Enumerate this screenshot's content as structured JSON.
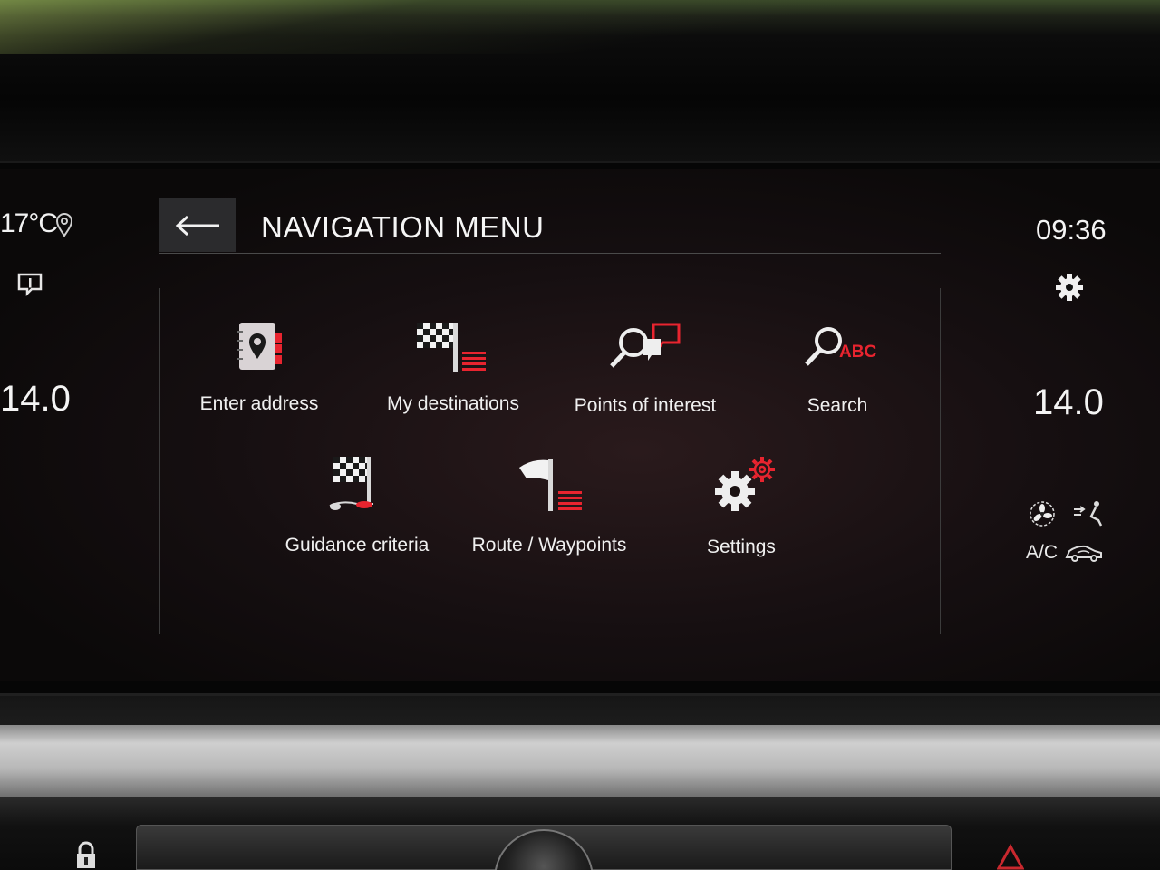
{
  "left_panel": {
    "temperature": "17°C",
    "value": "14.0"
  },
  "right_panel": {
    "clock": "09:36",
    "value": "14.0",
    "ac_label": "A/C"
  },
  "header": {
    "title": "NAVIGATION MENU"
  },
  "menu": {
    "items": [
      {
        "label": "Enter address",
        "icon": "address-book-pin-icon"
      },
      {
        "label": "My destinations",
        "icon": "checkered-flag-list-icon"
      },
      {
        "label": "Points of interest",
        "icon": "poi-search-icon"
      },
      {
        "label": "Search",
        "icon": "search-abc-icon"
      },
      {
        "label": "Guidance criteria",
        "icon": "guidance-flag-icon"
      },
      {
        "label": "Route / Waypoints",
        "icon": "route-flag-list-icon"
      },
      {
        "label": "Settings",
        "icon": "gears-icon"
      }
    ],
    "search_badge": "ABC"
  },
  "colors": {
    "accent": "#e8242f",
    "text": "#f0f0f0",
    "background": "#140e10"
  }
}
